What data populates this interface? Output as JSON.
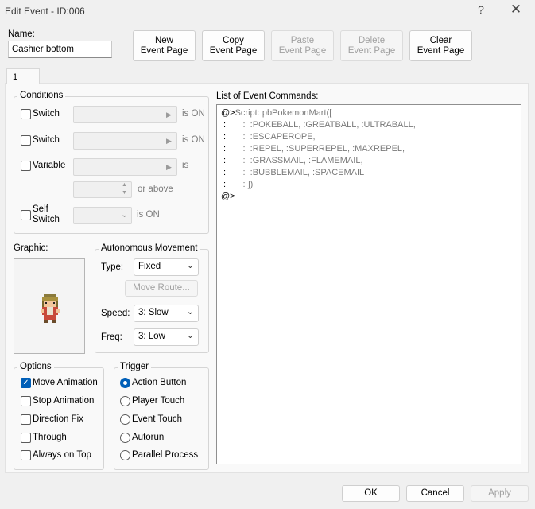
{
  "window": {
    "title": "Edit Event - ID:006",
    "help_glyph": "?",
    "close_glyph": "✕"
  },
  "name": {
    "label": "Name:",
    "value": "Cashier bottom"
  },
  "page_buttons": {
    "new": [
      "New",
      "Event Page"
    ],
    "copy": [
      "Copy",
      "Event Page"
    ],
    "paste": [
      "Paste",
      "Event Page"
    ],
    "delete": [
      "Delete",
      "Event Page"
    ],
    "clear": [
      "Clear",
      "Event Page"
    ]
  },
  "tabs": [
    "1"
  ],
  "conditions": {
    "title": "Conditions",
    "switch1": {
      "label": "Switch",
      "suffix": "is ON"
    },
    "switch2": {
      "label": "Switch",
      "suffix": "is ON"
    },
    "variable": {
      "label": "Variable",
      "suffix": "is",
      "or_above": "or above"
    },
    "self_switch": {
      "label_line1": "Self",
      "label_line2": "Switch",
      "suffix": "is ON"
    }
  },
  "graphic": {
    "label": "Graphic:"
  },
  "autonomous": {
    "title": "Autonomous Movement",
    "type_label": "Type:",
    "type_value": "Fixed",
    "move_route": "Move Route...",
    "speed_label": "Speed:",
    "speed_value": "3: Slow",
    "freq_label": "Freq:",
    "freq_value": "3: Low"
  },
  "options": {
    "title": "Options",
    "items": [
      {
        "label": "Move Animation",
        "checked": true
      },
      {
        "label": "Stop Animation",
        "checked": false
      },
      {
        "label": "Direction Fix",
        "checked": false
      },
      {
        "label": "Through",
        "checked": false
      },
      {
        "label": "Always on Top",
        "checked": false
      }
    ]
  },
  "trigger": {
    "title": "Trigger",
    "items": [
      {
        "label": "Action Button",
        "selected": true
      },
      {
        "label": "Player Touch",
        "selected": false
      },
      {
        "label": "Event Touch",
        "selected": false
      },
      {
        "label": "Autorun",
        "selected": false
      },
      {
        "label": "Parallel Process",
        "selected": false
      }
    ]
  },
  "commands": {
    "label": "List of Event Commands:",
    "lines": [
      {
        "prefix": "@>",
        "text": "Script: pbPokemonMart(["
      },
      {
        "prefix": " :",
        "text": "       :  :POKEBALL, :GREATBALL, :ULTRABALL,"
      },
      {
        "prefix": " :",
        "text": "       :  :ESCAPEROPE,"
      },
      {
        "prefix": " :",
        "text": "       :  :REPEL, :SUPERREPEL, :MAXREPEL,"
      },
      {
        "prefix": " :",
        "text": "       :  :GRASSMAIL, :FLAMEMAIL,"
      },
      {
        "prefix": " :",
        "text": "       :  :BUBBLEMAIL, :SPACEMAIL"
      },
      {
        "prefix": " :",
        "text": "       : ])"
      },
      {
        "prefix": "@>",
        "text": ""
      }
    ]
  },
  "footer": {
    "ok": "OK",
    "cancel": "Cancel",
    "apply": "Apply"
  },
  "colors": {
    "accent": "#005fb8"
  }
}
